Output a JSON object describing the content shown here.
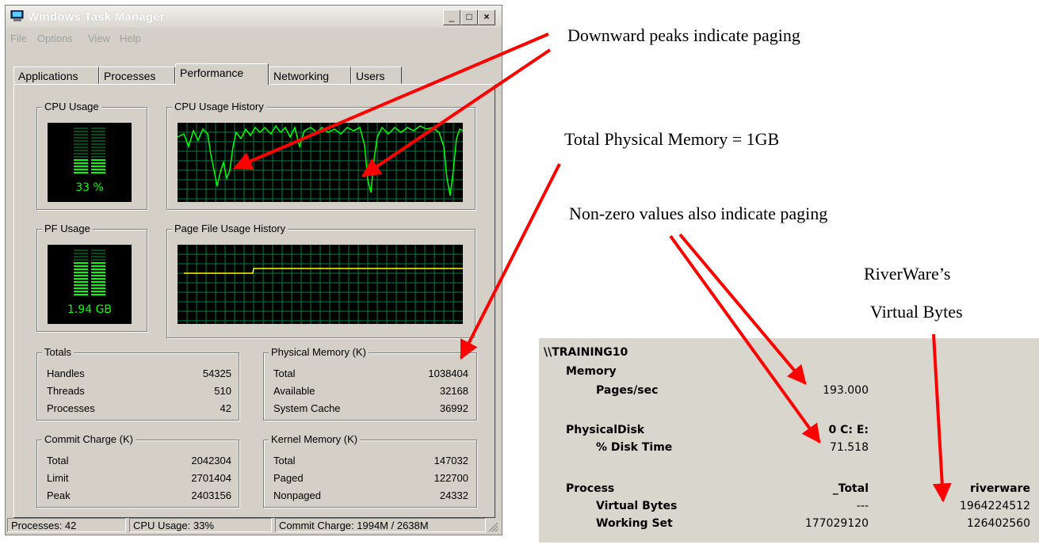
{
  "window": {
    "title": "Windows Task Manager",
    "menu": [
      "File",
      "Options",
      "View",
      "Help"
    ],
    "tabs": [
      "Applications",
      "Processes",
      "Performance",
      "Networking",
      "Users"
    ],
    "active_tab": "Performance"
  },
  "cpu_usage": {
    "label": "CPU Usage",
    "value": "33 %"
  },
  "cpu_history": {
    "label": "CPU Usage History"
  },
  "pf_usage": {
    "label": "PF Usage",
    "value": "1.94 GB"
  },
  "pf_history": {
    "label": "Page File Usage History"
  },
  "totals": {
    "label": "Totals",
    "rows": [
      {
        "k": "Handles",
        "v": "54325"
      },
      {
        "k": "Threads",
        "v": "510"
      },
      {
        "k": "Processes",
        "v": "42"
      }
    ]
  },
  "physical_memory": {
    "label": "Physical Memory (K)",
    "rows": [
      {
        "k": "Total",
        "v": "1038404"
      },
      {
        "k": "Available",
        "v": "32168"
      },
      {
        "k": "System Cache",
        "v": "36992"
      }
    ]
  },
  "commit_charge": {
    "label": "Commit Charge (K)",
    "rows": [
      {
        "k": "Total",
        "v": "2042304"
      },
      {
        "k": "Limit",
        "v": "2701404"
      },
      {
        "k": "Peak",
        "v": "2403156"
      }
    ]
  },
  "kernel_memory": {
    "label": "Kernel Memory (K)",
    "rows": [
      {
        "k": "Total",
        "v": "147032"
      },
      {
        "k": "Paged",
        "v": "122700"
      },
      {
        "k": "Nonpaged",
        "v": "24332"
      }
    ]
  },
  "statusbar": {
    "processes": "Processes: 42",
    "cpu": "CPU Usage: 33%",
    "commit": "Commit Charge: 1994M / 2638M"
  },
  "annotations": {
    "downward_peaks": "Downward peaks indicate paging",
    "total_physical": "Total Physical Memory = 1GB",
    "nonzero": "Non-zero values also indicate paging",
    "riverware_line1": "RiverWare’s",
    "riverware_line2": "Virtual Bytes"
  },
  "perfmon": {
    "machine": "\\\\TRAINING10",
    "memory": "Memory",
    "pages_sec_label": "Pages/sec",
    "pages_sec_value": "193.000",
    "physicaldisk": "PhysicalDisk",
    "disk_instance": "0 C: E:",
    "disk_time_label": "% Disk Time",
    "disk_time_value": "71.518",
    "process": "Process",
    "col_total": "_Total",
    "col_riverware": "riverware",
    "virtual_bytes_label": "Virtual Bytes",
    "virtual_bytes_total": "---",
    "virtual_bytes_riverware": "1964224512",
    "working_set_label": "Working Set",
    "working_set_total": "177029120",
    "working_set_riverware": "126402560"
  },
  "colors": {
    "graph_green": "#00ff00",
    "grid_green": "#008040",
    "pf_line": "#ffff00",
    "arrow_red": "#ff0000"
  }
}
